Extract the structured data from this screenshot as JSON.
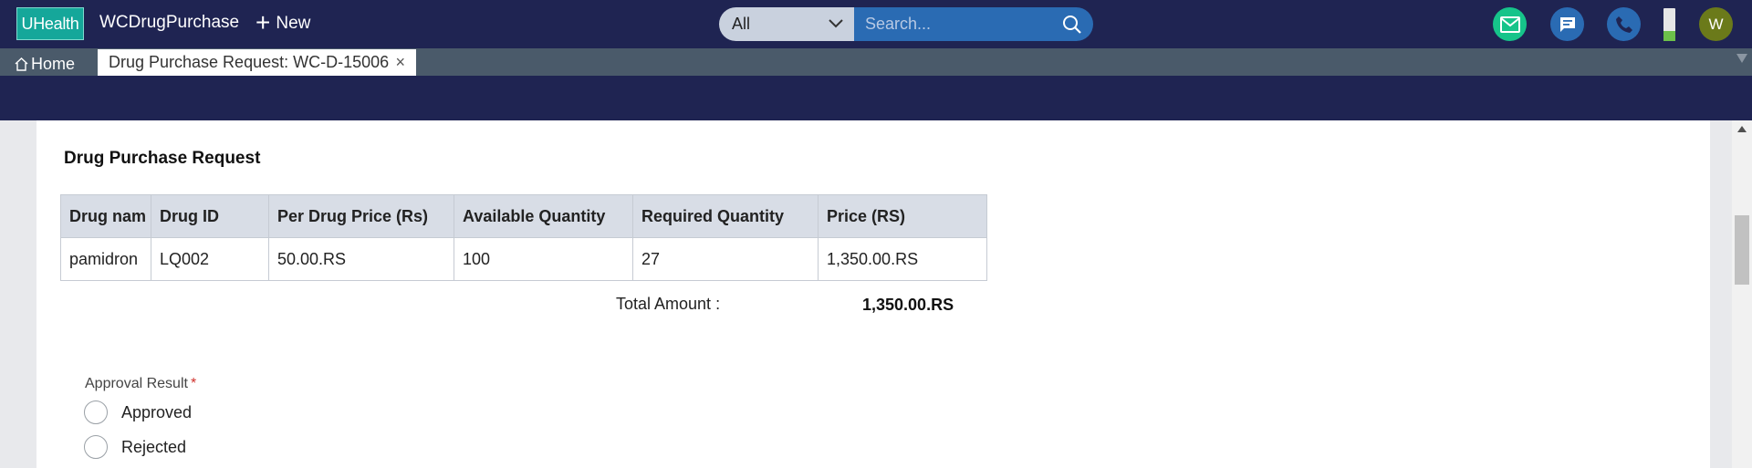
{
  "header": {
    "logo": "UHealth",
    "app_name": "WCDrugPurchase",
    "new_label": "New",
    "search_scope": "All",
    "search_placeholder": "Search...",
    "avatar_initial": "W",
    "battery_level_pct": 30
  },
  "tabs": {
    "home_label": "Home",
    "active_tab": "Drug Purchase Request: WC-D-15006",
    "close_glyph": "×"
  },
  "form": {
    "section_title": "Drug Purchase Request",
    "columns": [
      "Drug nam",
      "Drug ID",
      "Per Drug Price (Rs)",
      "Available Quantity",
      "Required Quantity",
      "Price (RS)"
    ],
    "rows": [
      [
        "pamidron",
        "LQ002",
        "50.00.RS",
        "100",
        "27",
        "1,350.00.RS"
      ]
    ],
    "total_label": "Total Amount :",
    "total_value": "1,350.00.RS",
    "approval_label": "Approval Result",
    "required_marker": "*",
    "approval_options": [
      "Approved",
      "Rejected"
    ]
  },
  "colors": {
    "header_bg": "#1f2452",
    "logo_bg": "#15a79a",
    "search_bg": "#2a6bb3",
    "mail_btn": "#16c48a",
    "avatar_bg": "#6b7a1a",
    "table_header_bg": "#d8dde6",
    "required": "#d0312d"
  },
  "icons": [
    "search-icon",
    "chevron-down-icon",
    "plus-icon",
    "mail-icon",
    "chat-icon",
    "phone-icon",
    "home-icon",
    "close-icon"
  ]
}
